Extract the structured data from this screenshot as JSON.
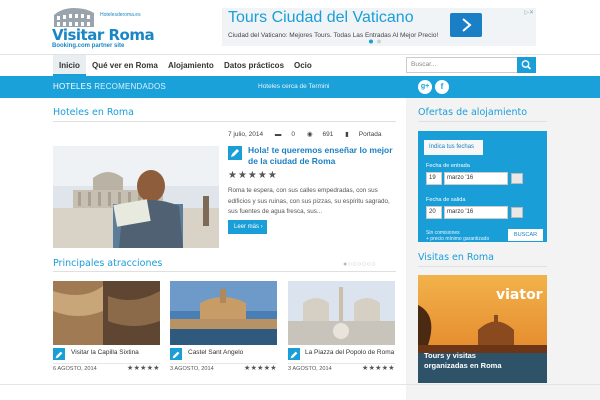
{
  "logo": {
    "brand": "Visitar Roma",
    "partner": "Booking.com partner site",
    "site": "Hotelesderoma.es"
  },
  "ad": {
    "headline": "Tours Ciudad del Vaticano",
    "text": "Ciudad del Vaticano: Mejores Tours. Todas Las Entradas Al Mejor Precio!",
    "button_icon": "chevron-right-icon"
  },
  "nav": {
    "items": [
      "Inicio",
      "Qué ver en Roma",
      "Alojamiento",
      "Datos prácticos",
      "Ocio"
    ],
    "active": "Inicio"
  },
  "search": {
    "placeholder": "Buscar..."
  },
  "bar": {
    "strong": "HOTELES",
    "light": "RECOMENDADOS",
    "right": "Hoteles cerca de Termini"
  },
  "hotels": {
    "heading": "Hoteles en Roma"
  },
  "article": {
    "date": "7 julio, 2014",
    "comments": "0",
    "views": "691",
    "category": "Portada",
    "title": "Hola! te queremos enseñar lo mejor de la ciudad de Roma",
    "stars": "★★★★★",
    "excerpt": "Roma te espera, con sus calles empedradas, con sus edificios y sus ruinas, con sus pizzas, su espíritu sagrado, sus fuentes de agua fresca, sus...",
    "readmore": "Leer más"
  },
  "attractions": {
    "heading": "Principales atracciones",
    "dots": "●○○○○○○",
    "items": [
      {
        "title": "Visitar la Capilla Sixtina",
        "date": "6 AGOSTO, 2014",
        "stars": "★★★★★"
      },
      {
        "title": "Castel Sant Angelo",
        "date": "3 AGOSTO, 2014",
        "stars": "★★★★★"
      },
      {
        "title": "La Piazza del Popolo de Roma",
        "date": "3 AGOSTO, 2014",
        "stars": "★★★★★"
      }
    ]
  },
  "offers": {
    "heading": "Ofertas de alojamiento",
    "tab": "Indica tus fechas",
    "checkin_label": "Fecha de entrada",
    "checkin_day": "19",
    "checkin_month": "marzo '16",
    "checkout_label": "Fecha de salida",
    "checkout_day": "20",
    "checkout_month": "marzo '16",
    "note1": "Sin comisiones",
    "note2": "+ precio mínimo garantizado",
    "button": "BUSCAR"
  },
  "visits": {
    "heading": "Visitas en Roma",
    "brand": "viator",
    "text1": "Tours y visitas",
    "text2": "organizadas en Roma"
  },
  "colors": {
    "accent": "#1aa1d9",
    "link": "#1a7fc4"
  }
}
